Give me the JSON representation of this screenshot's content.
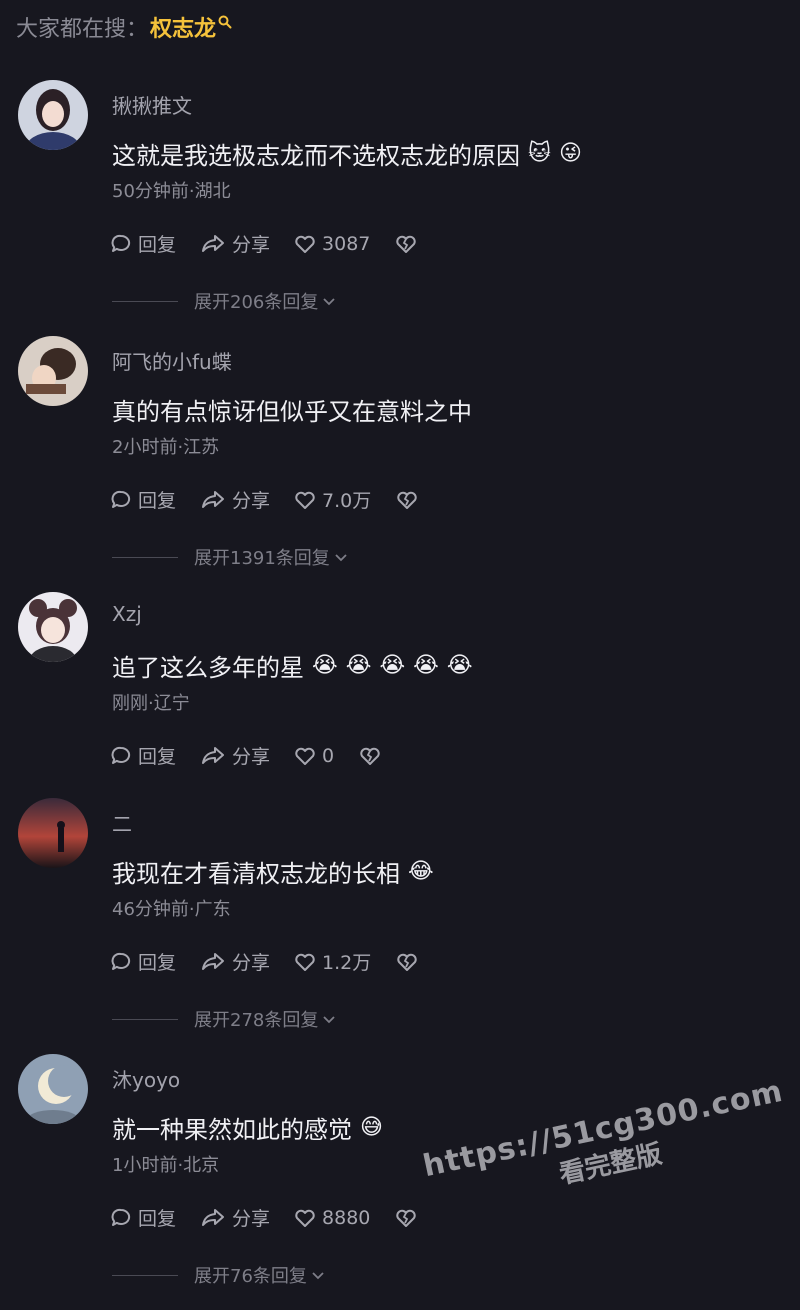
{
  "search_bar": {
    "prefix": "大家都在搜：",
    "term": "权志龙",
    "icon": "search-icon"
  },
  "comments": [
    {
      "username": "揪揪推文",
      "text": "这就是我选极志龙而不选权志龙的原因",
      "emojis": [
        "🐱",
        "😜"
      ],
      "meta": "50分钟前·湖北",
      "reply_label": "回复",
      "share_label": "分享",
      "likes": "3087",
      "expand_label": "展开206条回复"
    },
    {
      "username": "阿飞的小fu蝶",
      "text": "真的有点惊讶但似乎又在意料之中",
      "emojis": [],
      "meta": "2小时前·江苏",
      "reply_label": "回复",
      "share_label": "分享",
      "likes": "7.0万",
      "expand_label": "展开1391条回复"
    },
    {
      "username": "Xzj",
      "text": "追了这么多年的星",
      "emojis": [
        "😭",
        "😭",
        "😭",
        "😭",
        "😭"
      ],
      "meta": "刚刚·辽宁",
      "reply_label": "回复",
      "share_label": "分享",
      "likes": "0",
      "expand_label": ""
    },
    {
      "username": "二",
      "text": "我现在才看清权志龙的长相",
      "emojis": [
        "😂"
      ],
      "meta": "46分钟前·广东",
      "reply_label": "回复",
      "share_label": "分享",
      "likes": "1.2万",
      "expand_label": "展开278条回复"
    },
    {
      "username": "沐yoyo",
      "text": "就一种果然如此的感觉",
      "emojis": [
        "😅"
      ],
      "meta": "1小时前·北京",
      "reply_label": "回复",
      "share_label": "分享",
      "likes": "8880",
      "expand_label": "展开76条回复"
    }
  ],
  "watermark": {
    "url": "https://51cg300.com",
    "sub": "看完整版"
  },
  "colors": {
    "background": "#17171f",
    "accent": "#f5c23b",
    "text": "#f0f0f4",
    "muted": "#8c8c96"
  }
}
